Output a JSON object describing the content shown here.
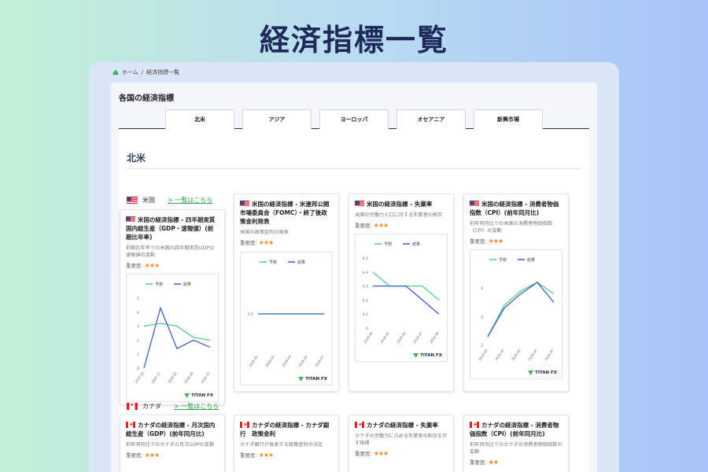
{
  "hero": {
    "title": "経済指標一覧"
  },
  "breadcrumb": {
    "home": "ホーム",
    "separator": "/",
    "current": "経済指標一覧"
  },
  "panel": {
    "title": "各国の経済指標"
  },
  "tabs": [
    {
      "label": "北米"
    },
    {
      "label": "アジア"
    },
    {
      "label": "ヨーロッパ"
    },
    {
      "label": "オセアニア"
    },
    {
      "label": "新興市場"
    }
  ],
  "region": {
    "title": "北米"
  },
  "importance_label": "重要度:",
  "legend": {
    "forecast": "予想",
    "result": "結果"
  },
  "colors": {
    "forecast": "#4fcf8a",
    "result": "#3a5fcd",
    "stars": "#f08a1c",
    "link": "#2fa34a"
  },
  "logo": "TITAN FX",
  "countries": [
    {
      "name": "米国",
      "link": "> 一覧はこちら",
      "flag": "us-flag",
      "cards": [
        {
          "title": "米国の経済指標 - 四半期実質国内総生産（GDP・速報値）(前期比年率)",
          "desc": "前期比年率での米国の四半期実質GDPの速報値の変動",
          "stars": "★★★",
          "chart_data": {
            "type": "line",
            "x": [
              "2025-10",
              "2025-12",
              "2026-02",
              "2026-04",
              "2026-07"
            ],
            "yticks": [
              0,
              1,
              2,
              3,
              4,
              5
            ],
            "ylim": [
              0,
              5
            ],
            "series": [
              {
                "name": "予想",
                "x": [
                  "2025-10",
                  "2025-11",
                  "2025-12",
                  "2026-02",
                  "2026-04",
                  "2026-07"
                ],
                "values": [
                  3.0,
                  3.2,
                  3.0,
                  2.2,
                  2.0
                ]
              },
              {
                "name": "結果",
                "values": [
                  0.0,
                  4.3,
                  1.4,
                  2.0,
                  1.5
                ]
              }
            ]
          }
        },
        {
          "title": "米国の経済指標 - 米連邦公開市場委員会（FOMC）・終了後政策金利発表",
          "desc": "米国の政策金利の発表",
          "stars": "★★★",
          "chart_data": {
            "type": "line",
            "x": [
              "2026-01",
              "2026-03",
              "2026-04",
              "2026-06",
              "2026-07"
            ],
            "yticks": [
              2.5
            ],
            "ylim": [
              0,
              5
            ],
            "series": [
              {
                "name": "予想",
                "values": [
                  2.5,
                  2.5,
                  2.5,
                  2.5,
                  2.5
                ]
              },
              {
                "name": "結果",
                "values": [
                  2.5,
                  2.5,
                  2.5,
                  2.5,
                  2.5
                ]
              }
            ]
          }
        },
        {
          "title": "米国の経済指標 - 失業率",
          "desc": "米国の労働力人口に対する失業者の割合",
          "stars": "★★★",
          "chart_data": {
            "type": "line",
            "x": [
              "2026-04",
              "2026-05",
              "2026-06",
              "2026-07",
              "2026-08"
            ],
            "yticks": [
              4,
              4.1,
              4.2,
              4.3,
              4.4,
              4.5
            ],
            "ylim": [
              4,
              4.5
            ],
            "series": [
              {
                "name": "予想",
                "values": [
                  4.4,
                  4.3,
                  4.3,
                  4.3,
                  4.2
                ]
              },
              {
                "name": "結果",
                "values": [
                  4.3,
                  4.3,
                  4.3,
                  4.2,
                  4.1
                ]
              }
            ]
          }
        },
        {
          "title": "米国の経済指標 - 消費者物価指数（CPI）(前年同月比)",
          "desc": "前年同月比での米国の消費者物価指数（CPI）の変動",
          "stars": "★★★",
          "chart_data": {
            "type": "line",
            "x": [
              "2026-03",
              "2026-04",
              "2026-05",
              "2026-06",
              "2026-07"
            ],
            "yticks": [
              2,
              3,
              4
            ],
            "ylim": [
              2,
              4.5
            ],
            "series": [
              {
                "name": "予想",
                "values": [
                  2.3,
                  3.4,
                  3.9,
                  4.2,
                  3.8
                ]
              },
              {
                "name": "結果",
                "values": [
                  2.3,
                  3.3,
                  3.8,
                  4.2,
                  3.5
                ]
              }
            ]
          }
        }
      ]
    },
    {
      "name": "カナダ",
      "link": "> 一覧はこちら",
      "flag": "canada-flag",
      "cards": [
        {
          "title": "カナダの経済指標 - 月次国内総生産（GDP）(前年同月比)",
          "desc": "前年同月比でのカナダの月次GDPの変動",
          "stars": "★★★"
        },
        {
          "title": "カナダの経済指標 - カナダ銀行　政策金利",
          "desc": "カナダ銀行が発表する政策金利の決定",
          "stars": "★★★"
        },
        {
          "title": "カナダの経済指標 - 失業率",
          "desc": "カナダの労働力に占める失業者の割合を示す指標",
          "stars": "★★★"
        },
        {
          "title": "カナダの経済指標 - 消費者物価指数（CPI）(前年同月比)",
          "desc": "前年同月比でのカナダの消費者物価指数の変動",
          "stars": "★★"
        }
      ]
    }
  ]
}
